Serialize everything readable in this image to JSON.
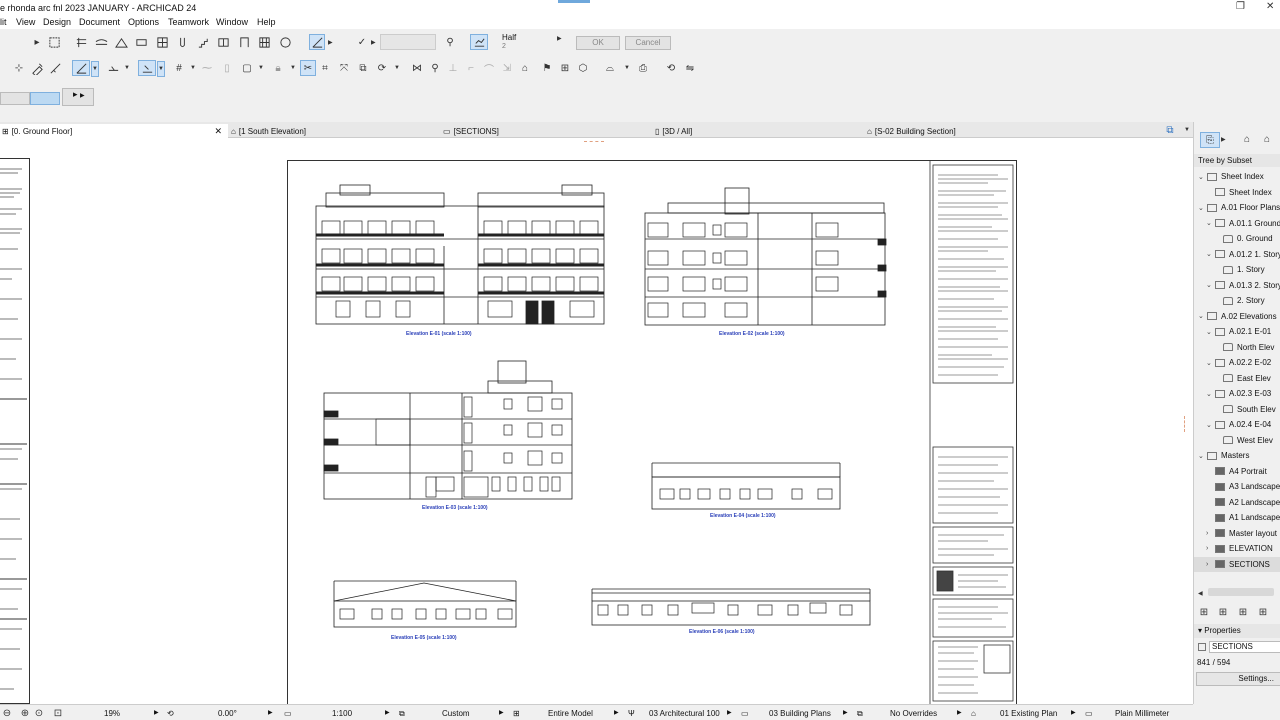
{
  "window": {
    "title": "e rhonda arc fnl 2023 JANUARY - ARCHICAD 24"
  },
  "menu": [
    "lit",
    "View",
    "Design",
    "Document",
    "Options",
    "Teamwork",
    "Window",
    "Help"
  ],
  "info_box": {
    "pen_label": "Half",
    "pen_value": "2",
    "ok": "OK",
    "cancel": "Cancel"
  },
  "tabs": [
    "[0. Ground Floor]",
    "[1 South Elevation]",
    "[SECTIONS]",
    "[3D / All]",
    "[S-02 Building Section]"
  ],
  "drawings": [
    {
      "caption": "Elevation E-01 (scale 1:100)"
    },
    {
      "caption": "Elevation E-02 (scale 1:100)"
    },
    {
      "caption": "Elevation E-03 (scale 1:100)"
    },
    {
      "caption": "Elevation E-04 (scale 1:100)"
    },
    {
      "caption": "Elevation E-05 (scale 1:100)"
    },
    {
      "caption": "Elevation E-06 (scale 1:100)"
    }
  ],
  "navigator": {
    "header": "Tree by Subset",
    "items": [
      {
        "label": "Sheet Index",
        "indent": 1,
        "exp": "v",
        "icon": "folder"
      },
      {
        "label": "Sheet Index",
        "indent": 2,
        "exp": "",
        "icon": "folder"
      },
      {
        "label": "A.01 Floor Plans",
        "indent": 1,
        "exp": "v",
        "icon": "folder"
      },
      {
        "label": "A.01.1 Ground",
        "indent": 2,
        "exp": "v",
        "icon": "folder"
      },
      {
        "label": "0. Ground",
        "indent": 3,
        "exp": "",
        "icon": "view"
      },
      {
        "label": "A.01.2 1. Story",
        "indent": 2,
        "exp": "v",
        "icon": "folder"
      },
      {
        "label": "1. Story",
        "indent": 3,
        "exp": "",
        "icon": "view"
      },
      {
        "label": "A.01.3 2. Story",
        "indent": 2,
        "exp": "v",
        "icon": "folder"
      },
      {
        "label": "2. Story",
        "indent": 3,
        "exp": "",
        "icon": "view"
      },
      {
        "label": "A.02 Elevations",
        "indent": 1,
        "exp": "v",
        "icon": "folder"
      },
      {
        "label": "A.02.1 E-01",
        "indent": 2,
        "exp": "v",
        "icon": "folder"
      },
      {
        "label": "North Elev",
        "indent": 3,
        "exp": "",
        "icon": "elev"
      },
      {
        "label": "A.02.2 E-02",
        "indent": 2,
        "exp": "v",
        "icon": "folder"
      },
      {
        "label": "East Elev",
        "indent": 3,
        "exp": "",
        "icon": "elev"
      },
      {
        "label": "A.02.3 E-03",
        "indent": 2,
        "exp": "v",
        "icon": "folder"
      },
      {
        "label": "South Elev",
        "indent": 3,
        "exp": "",
        "icon": "elev"
      },
      {
        "label": "A.02.4 E-04",
        "indent": 2,
        "exp": "v",
        "icon": "folder"
      },
      {
        "label": "West Elev",
        "indent": 3,
        "exp": "",
        "icon": "elev"
      },
      {
        "label": "Masters",
        "indent": 1,
        "exp": "v",
        "icon": "folder"
      },
      {
        "label": "A4 Portrait",
        "indent": 2,
        "exp": "",
        "icon": "master"
      },
      {
        "label": "A3 Landscape",
        "indent": 2,
        "exp": "",
        "icon": "master"
      },
      {
        "label": "A2 Landscape",
        "indent": 2,
        "exp": "",
        "icon": "master"
      },
      {
        "label": "A1 Landscape",
        "indent": 2,
        "exp": "",
        "icon": "master"
      },
      {
        "label": "Master layout",
        "indent": 2,
        "exp": ">",
        "icon": "master"
      },
      {
        "label": "ELEVATION",
        "indent": 2,
        "exp": ">",
        "icon": "master"
      },
      {
        "label": "SECTIONS",
        "indent": 2,
        "exp": ">",
        "icon": "master"
      }
    ]
  },
  "properties": {
    "header": "Properties",
    "name": "SECTIONS",
    "size": "841 / 594",
    "settings": "Settings..."
  },
  "status": {
    "zoom": "19%",
    "angle": "0.00°",
    "scale": "1:100",
    "layer": "Custom",
    "model": "Entire Model",
    "pen": "03 Architectural 100",
    "mvo": "03 Building Plans",
    "override": "No Overrides",
    "reno": "01 Existing Plan",
    "dim": "Plain Millimeter"
  }
}
